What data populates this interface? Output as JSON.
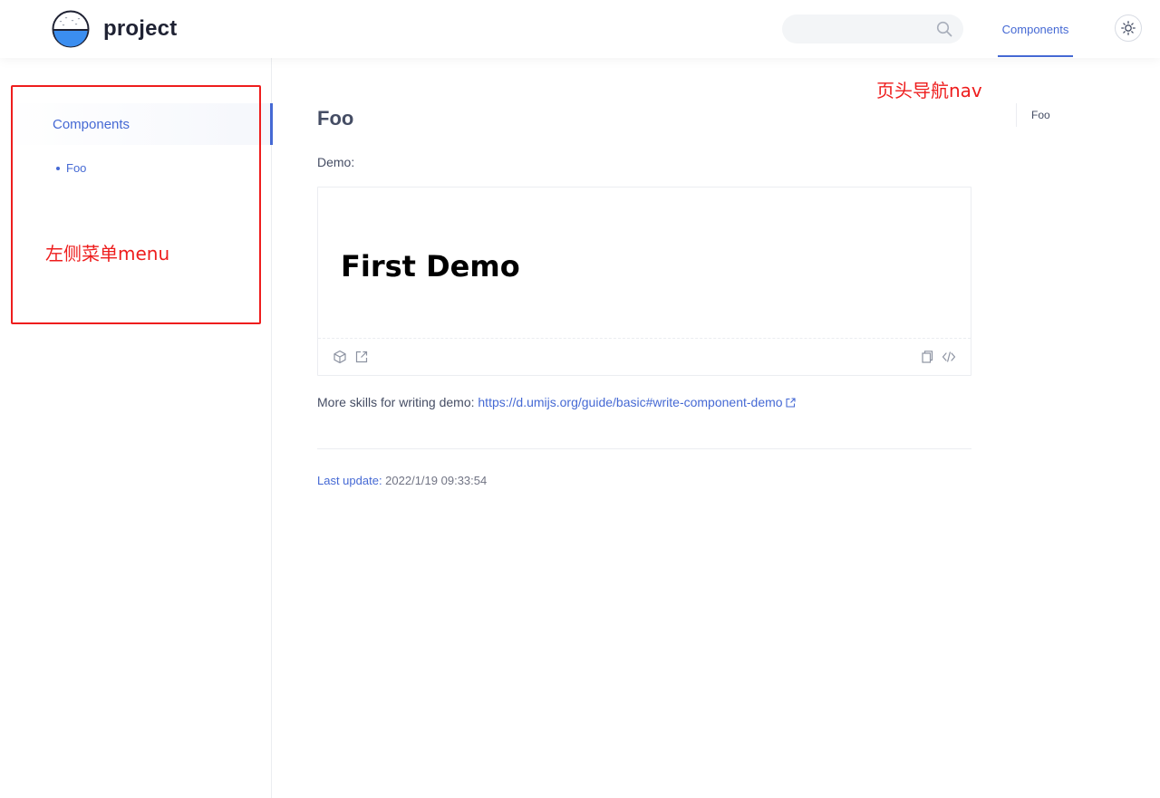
{
  "header": {
    "site_title": "project",
    "search": {
      "value": "",
      "placeholder": ""
    },
    "nav_items": [
      {
        "label": "Components",
        "active": true
      }
    ],
    "theme_icon": "sun-icon"
  },
  "sidebar": {
    "group_label": "Components",
    "items": [
      {
        "label": "Foo",
        "active": true
      }
    ]
  },
  "main": {
    "title": "Foo",
    "demo_label": "Demo:",
    "demo": {
      "heading": "First Demo"
    },
    "more_text": "More skills for writing demo: ",
    "more_link": "https://d.umijs.org/guide/basic#write-component-demo",
    "last_update_label": "Last update:",
    "last_update_value": " 2022/1/19 09:33:54"
  },
  "toc": {
    "items": [
      "Foo"
    ]
  },
  "annotations": {
    "nav_label": "页头导航nav",
    "menu_label": "左侧菜单menu",
    "color": "#ee1d1d"
  },
  "colors": {
    "accent": "#4569d4",
    "text": "#454d64",
    "border": "#ebedf1"
  }
}
